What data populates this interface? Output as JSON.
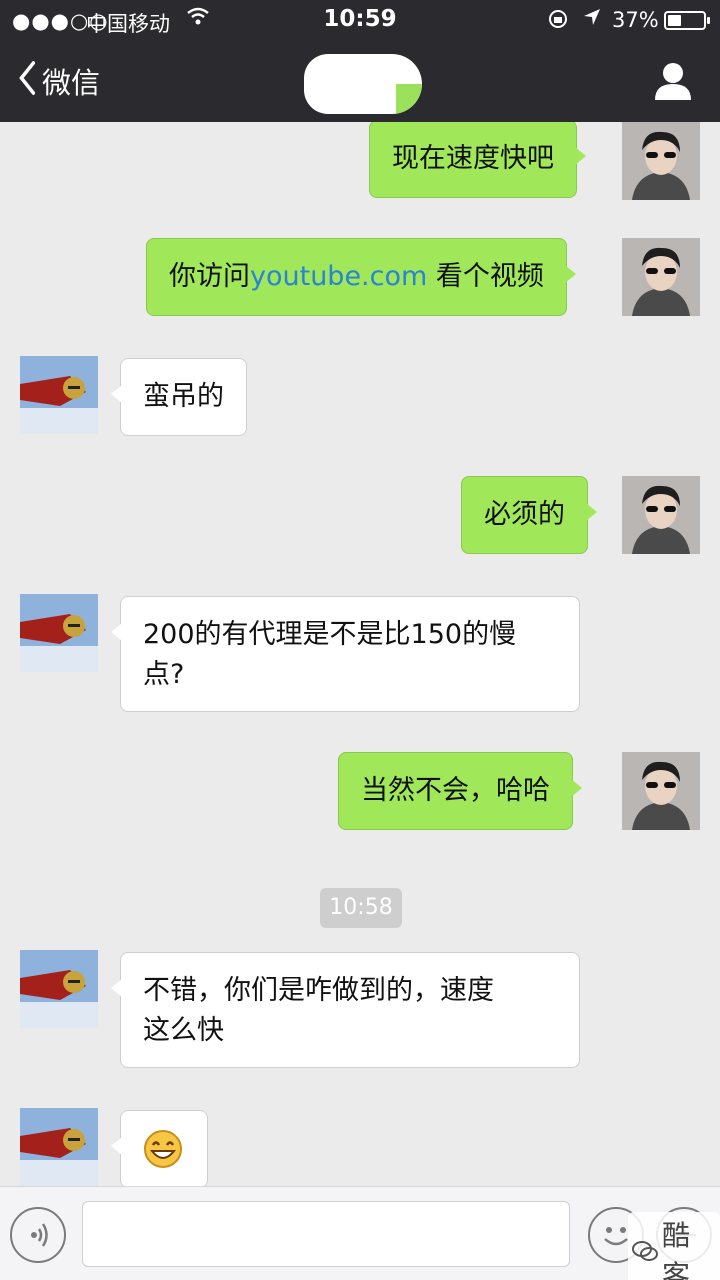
{
  "status_bar": {
    "signal": "●●●○○",
    "carrier": "中国移动",
    "time": "10:59",
    "battery_percent": "37%",
    "battery_level": 0.37
  },
  "nav": {
    "back_label": "微信",
    "title": ""
  },
  "messages": [
    {
      "side": "me",
      "text": "现在速度快吧"
    },
    {
      "side": "me",
      "text_before": "你访问",
      "link": "youtube.com",
      "text_after": " 看个视频"
    },
    {
      "side": "other",
      "text": "蛮吊的"
    },
    {
      "side": "me",
      "text": "必须的"
    },
    {
      "side": "other",
      "text_line1": "200的有代理是不是比150的慢",
      "text_line2": "点?"
    },
    {
      "side": "me",
      "text": "当然不会，哈哈"
    },
    {
      "type": "timestamp",
      "text": "10:58"
    },
    {
      "side": "other",
      "text_line1": "不错，你们是咋做到的，速度",
      "text_line2": "这么快"
    },
    {
      "side": "other",
      "emoji": "😁"
    }
  ],
  "input": {
    "value": "",
    "placeholder": ""
  },
  "watermark": {
    "text": "酷客"
  },
  "icons": {
    "wifi": "wifi-icon",
    "lock_rotation": "rotation-lock-icon",
    "location": "location-arrow-icon",
    "profile": "person-icon",
    "voice": "voice-icon",
    "emoji": "emoji-icon",
    "more": "plus-icon"
  },
  "colors": {
    "nav_bg": "#2a2a2f",
    "chat_bg": "#ebebeb",
    "my_bubble": "#a0e75a",
    "other_bubble": "#ffffff",
    "link": "#2a83d4"
  }
}
